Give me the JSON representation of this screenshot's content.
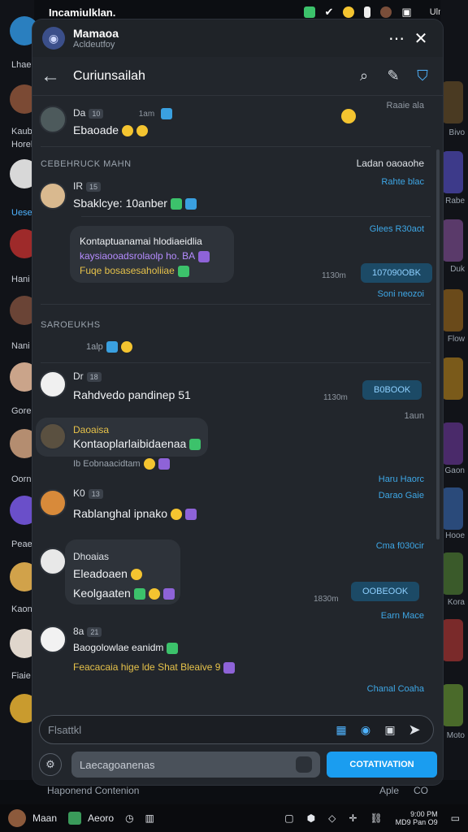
{
  "statusbar": {
    "title": "Incamiulklan.",
    "right": "Ulmabs"
  },
  "left_rail": {
    "labels": [
      "Lhaen",
      "Kaub",
      "Horelt",
      "Uesen",
      "Hani",
      "Nani",
      "Gorei",
      "Oornu",
      "Peae",
      "Kaon",
      "Fiaie"
    ]
  },
  "right_rail": {
    "labels": [
      "Bivo",
      "Rabe",
      "Duk",
      "Flow",
      "Gaon",
      "Hooe",
      "Kora",
      "Moto"
    ]
  },
  "header": {
    "title": "Mamaoa",
    "subtitle": "Acldeutfoy"
  },
  "channel": {
    "title": "Curiunsailah"
  },
  "messages": {
    "m1": {
      "author": "Da",
      "badge": "10",
      "time": "1am",
      "text": "Ebaoade",
      "meta_right": "Raaie ala"
    },
    "sys1": {
      "label": "CEBEHRUCK MAHN",
      "right": "Ladan oaoaohe",
      "link": "Rahte blac"
    },
    "m2": {
      "author": "IR",
      "badge": "15",
      "text": "Sbaklcye: 10anber",
      "link": "Glees R30aot"
    },
    "m3": {
      "line1": "Kontaptuanamai hlodiaeidlia",
      "line2": "kaysiaooadsrolaolp ho. BA",
      "line3": "Fuqe bosasesaholiiae",
      "time": "1130m",
      "pill": "107090OBK",
      "link": "Soni neozoi"
    },
    "sys2": {
      "label": "SAROEUKHS",
      "sub": "1alp"
    },
    "m4": {
      "author": "Dr",
      "badge": "18",
      "text": "Rahdvedo pandinep 51",
      "time": "1130m",
      "pill": "B0BOOK",
      "link": "1aun"
    },
    "m5": {
      "author": "Daoaisa",
      "text": "Kontaoplarlaibidaenaa",
      "sub": "Ib Eobnaacidtam"
    },
    "m6": {
      "author": "K0",
      "badge": "13",
      "text": "Rablanghal ipnako",
      "link1": "Haru Haorc",
      "link2": "Darao Gaie"
    },
    "m7": {
      "author": "Dhoaias",
      "text": "Eleadoaen",
      "sub": "Keolgaaten",
      "time": "1830m",
      "pill": "OOBEOOK",
      "link1": "Cma f030cir",
      "link2": "Earn Mace"
    },
    "m8": {
      "author": "8a",
      "badge": "21",
      "text": "Baogolowlae eanidm",
      "line2": "Feacacaia hige lde Shat Bleaive 9",
      "link": "Chanal Coaha"
    }
  },
  "composer": {
    "placeholder": "Flsattkl"
  },
  "bottom": {
    "field": "Laecagoanenas",
    "button": "COTATIVATION"
  },
  "below_panel": {
    "left": "Haponend Contenion",
    "right1": "Aple",
    "right2": "CO"
  },
  "taskbar": {
    "user": "Maan",
    "app": "Aeoro",
    "time1": "9:00 PM",
    "time2": "MD9 Pan O9"
  },
  "colors": {
    "accent": "#1a9df0",
    "panel": "#22262c",
    "link": "#3ea7e6"
  }
}
